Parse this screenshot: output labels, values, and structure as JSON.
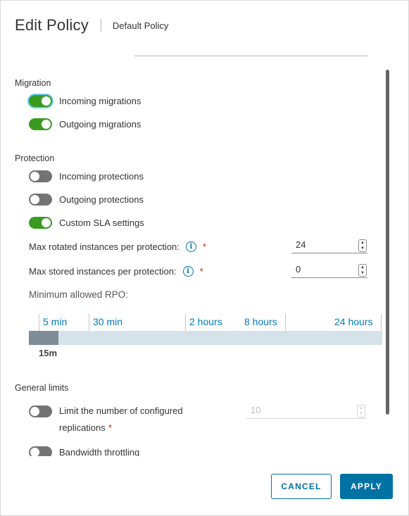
{
  "header": {
    "title": "Edit Policy",
    "subtitle": "Default Policy"
  },
  "migration": {
    "section_label": "Migration",
    "incoming": {
      "label": "Incoming migrations",
      "on": true
    },
    "outgoing": {
      "label": "Outgoing migrations",
      "on": true
    }
  },
  "protection": {
    "section_label": "Protection",
    "incoming": {
      "label": "Incoming protections",
      "on": false
    },
    "outgoing": {
      "label": "Outgoing protections",
      "on": false
    },
    "custom_sla": {
      "label": "Custom SLA settings",
      "on": true
    },
    "max_rotated": {
      "label": "Max rotated instances per protection:",
      "value": "24",
      "required_mark": "*"
    },
    "max_stored": {
      "label": "Max stored instances per protection:",
      "value": "0",
      "required_mark": "*"
    },
    "rpo": {
      "label": "Minimum allowed RPO:",
      "ticks": [
        "5 min",
        "30 min",
        "2 hours",
        "8 hours",
        "24 hours"
      ],
      "value_label": "15m",
      "value_minutes": 15
    }
  },
  "general_limits": {
    "section_label": "General limits",
    "limit_replications": {
      "label": "Limit the number of configured",
      "label_line2": "replications",
      "required_mark": "*",
      "on": false,
      "value": "10"
    },
    "bandwidth": {
      "label": "Bandwidth throttling",
      "on": false
    }
  },
  "footer": {
    "cancel_label": "CANCEL",
    "apply_label": "APPLY"
  },
  "colors": {
    "toggle_on": "#3a9b21",
    "toggle_off": "#737373",
    "primary": "#0072a3",
    "required": "#c92100"
  },
  "icons": {
    "info": "info-circle-icon",
    "spinner": "spinner-arrows-icon"
  }
}
